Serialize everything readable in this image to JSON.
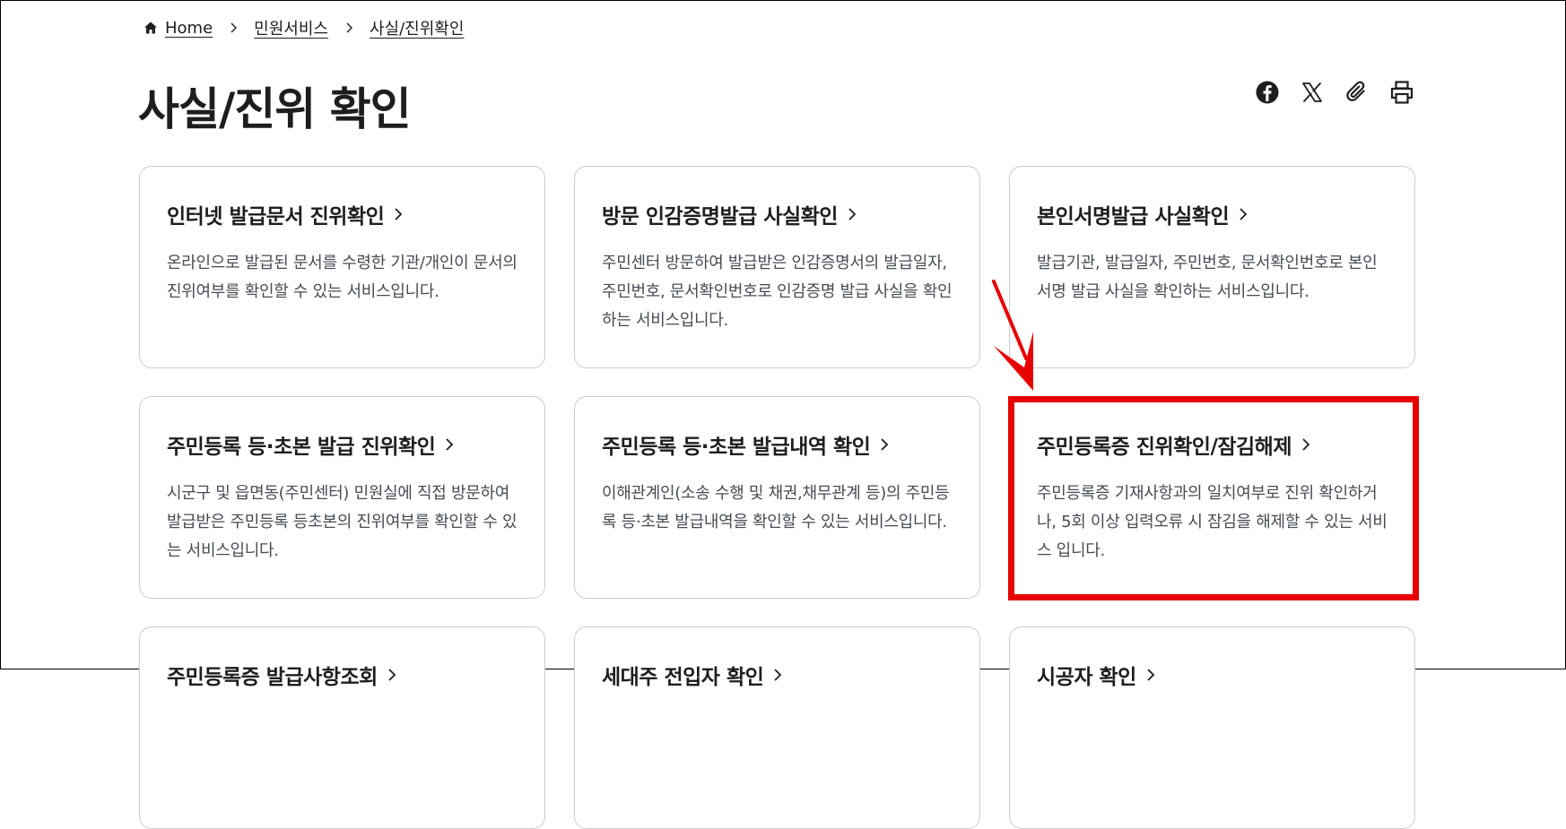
{
  "breadcrumb": {
    "home": "Home",
    "level1": "민원서비스",
    "level2": "사실/진위확인"
  },
  "page": {
    "title": "사실/진위 확인"
  },
  "share": {
    "icons": [
      "facebook-icon",
      "x-icon",
      "paperclip-icon",
      "print-icon"
    ]
  },
  "cards": [
    {
      "title": "인터넷 발급문서 진위확인",
      "desc": "온라인으로 발급된 문서를 수령한 기관/개인이 문서의 진위여부를 확인할 수 있는 서비스입니다."
    },
    {
      "title": "방문 인감증명발급 사실확인",
      "desc": "주민센터 방문하여 발급받은 인감증명서의 발급일자, 주민번호, 문서확인번호로 인감증명 발급 사실을 확인하는 서비스입니다."
    },
    {
      "title": "본인서명발급 사실확인",
      "desc": "발급기관, 발급일자, 주민번호, 문서확인번호로 본인서명 발급 사실을 확인하는 서비스입니다."
    },
    {
      "title": "주민등록 등·초본 발급 진위확인",
      "desc": "시군구 및 읍면동(주민센터) 민원실에 직접 방문하여 발급받은 주민등록 등초본의 진위여부를 확인할 수 있는 서비스입니다."
    },
    {
      "title": "주민등록 등·초본 발급내역 확인",
      "desc": "이해관계인(소송 수행 및 채권,채무관계 등)의 주민등록 등·초본 발급내역을 확인할 수 있는 서비스입니다."
    },
    {
      "title": "주민등록증 진위확인/잠김해제",
      "desc": "주민등록증 기재사항과의 일치여부로 진위 확인하거나, 5회 이상 입력오류 시 잠김을 해제할 수 있는 서비스 입니다."
    },
    {
      "title": "주민등록증 발급사항조회",
      "desc": ""
    },
    {
      "title": "세대주 전입자 확인",
      "desc": ""
    },
    {
      "title": "시공자 확인",
      "desc": ""
    }
  ],
  "colors": {
    "highlight": "#e60000",
    "border": "#c9ccd1",
    "text": "#1e1e1e",
    "desc": "#464c53"
  }
}
